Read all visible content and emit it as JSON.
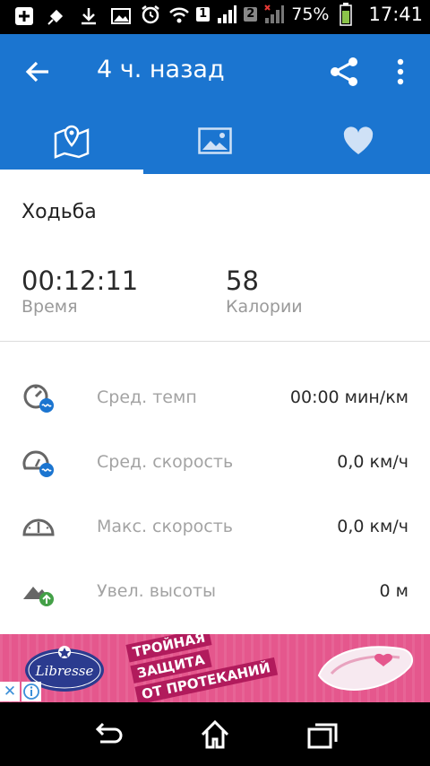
{
  "status_bar": {
    "sim1": "1",
    "sim2": "2",
    "battery": "75%",
    "time": "17:41"
  },
  "app_bar": {
    "title": "4 ч. назад"
  },
  "tabs": [
    {
      "icon": "map-pin-icon",
      "selected": true
    },
    {
      "icon": "image-icon",
      "selected": false
    },
    {
      "icon": "heart-icon",
      "selected": false
    }
  ],
  "summary": {
    "activity": "Ходьба",
    "time_value": "00:12:11",
    "time_label": "Время",
    "calories_value": "58",
    "calories_label": "Калории"
  },
  "metrics": [
    {
      "label": "Сред. темп",
      "value": "00:00 мин/км",
      "icon": "avg-pace-icon"
    },
    {
      "label": "Сред. скорость",
      "value": "0,0 км/ч",
      "icon": "avg-speed-icon"
    },
    {
      "label": "Макс. скорость",
      "value": "0,0 км/ч",
      "icon": "max-speed-icon"
    },
    {
      "label": "Увел. высоты",
      "value": "0 м",
      "icon": "elevation-gain-icon"
    }
  ],
  "ad": {
    "brand": "Libresse",
    "line1": "ТРОЙНАЯ",
    "line2": "ЗАЩИТА",
    "line3": "ОТ ПРОТЕКАНИЙ",
    "close_glyph": "✕"
  },
  "colors": {
    "primary": "#1b75d0",
    "ad_bg": "#e5578d"
  }
}
